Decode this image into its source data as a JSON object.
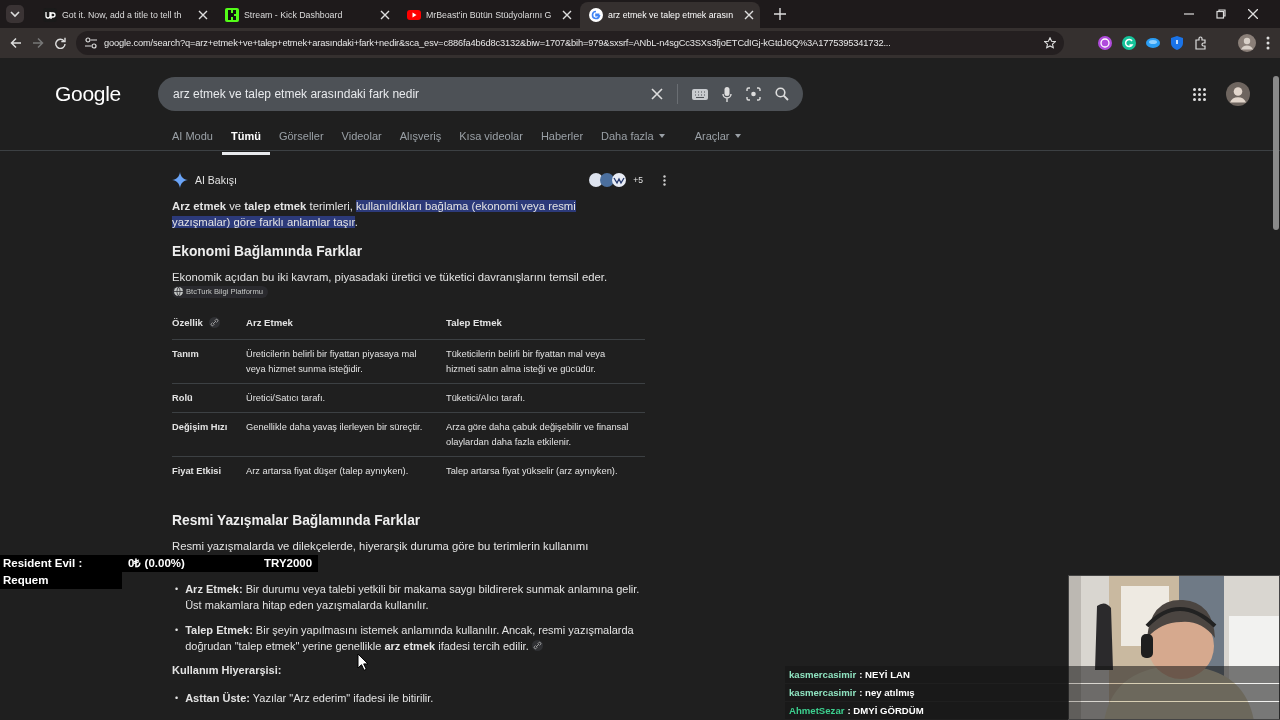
{
  "browser": {
    "tabs": [
      {
        "title": "Got it. Now, add a title to tell th",
        "selected": false
      },
      {
        "title": "Stream - Kick Dashboard",
        "selected": false
      },
      {
        "title": "MrBeast'in Bütün Stüdyolarını G",
        "selected": false
      },
      {
        "title": "arz etmek ve talep etmek arasın",
        "selected": true
      }
    ],
    "address": "google.com/search?q=arz+etmek+ve+talep+etmek+arasındaki+fark+nedir&sca_esv=c886fa4b6d8c3132&biw=1707&bih=979&sxsrf=ANbL-n4sgCc3SXs3fjoETCdIGj-kGtdJ6Q%3A1775395341732..."
  },
  "search": {
    "logo": "Google",
    "query": "arz etmek ve talep etmek arasındaki fark nedir",
    "nav": [
      {
        "label": "AI Modu",
        "selected": false,
        "dropdown": false
      },
      {
        "label": "Tümü",
        "selected": true,
        "dropdown": false
      },
      {
        "label": "Görseller",
        "selected": false,
        "dropdown": false
      },
      {
        "label": "Videolar",
        "selected": false,
        "dropdown": false
      },
      {
        "label": "Alışveriş",
        "selected": false,
        "dropdown": false
      },
      {
        "label": "Kısa videolar",
        "selected": false,
        "dropdown": false
      },
      {
        "label": "Haberler",
        "selected": false,
        "dropdown": false
      },
      {
        "label": "Daha fazla",
        "selected": false,
        "dropdown": true
      },
      {
        "label": "Araçlar",
        "selected": false,
        "dropdown": true
      }
    ]
  },
  "overview": {
    "title": "AI Bakışı",
    "source_count": "+5",
    "intro": "**Arz etmek** ve **talep etmek** terimleri, ",
    "intro_highlight": "kullanıldıkları bağlama (ekonomi veya resmi yazışmalar) göre farklı anlamlar taşır",
    "intro_end": ".",
    "section1": {
      "heading": "Ekonomi Bağlamında Farklar",
      "text": "Ekonomik açıdan bu iki kavram, piyasadaki üretici ve tüketici davranışlarını temsil eder.",
      "source": "BtcTurk Bilgi Platformu",
      "table": {
        "columns": [
          "Özellik",
          "Arz Etmek",
          "Talep Etmek"
        ],
        "rows": [
          [
            "Tanım",
            "Üreticilerin belirli bir fiyattan piyasaya mal veya hizmet sunma isteğidir.",
            "Tüketicilerin belirli bir fiyattan mal veya hizmeti satın alma isteği ve gücüdür."
          ],
          [
            "Rolü",
            "Üretici/Satıcı tarafı.",
            "Tüketici/Alıcı tarafı."
          ],
          [
            "Değişim Hızı",
            "Genellikle daha yavaş ilerleyen bir süreçtir.",
            "Arza göre daha çabuk değişebilir ve finansal olaylardan daha fazla etkilenir."
          ],
          [
            "Fiyat Etkisi",
            "Arz artarsa fiyat düşer (talep aynıyken).",
            "Talep artarsa fiyat yükselir (arz aynıyken)."
          ]
        ]
      }
    },
    "section2": {
      "heading": "Resmi Yazışmalar Bağlamında Farklar",
      "text": "Resmi yazışmalarda ve dilekçelerde, hiyerarşik duruma göre bu terimlerin kullanımı",
      "bullets": [
        {
          "marker": "•",
          "text": "**Arz Etmek:** Bir durumu veya talebi yetkili bir makama saygı bildirerek sunmak anlamına gelir. Üst makamlara hitap eden yazışmalarda kullanılır.",
          "link": false
        },
        {
          "marker": "•",
          "text": "**Talep Etmek:** Bir şeyin yapılmasını istemek anlamında kullanılır. Ancak, resmi yazışmalarda doğrudan \"talep etmek\" yerine genellikle **arz etmek** ifadesi tercih edilir.",
          "link": true
        }
      ],
      "subheading": "Kullanım Hiyerarşisi:",
      "bullets2": [
        {
          "marker": "•",
          "text": "**Asttan Üste:** Yazılar \"Arz ederim\" ifadesi ile bitirilir.",
          "link": false
        }
      ]
    }
  },
  "overlay": {
    "donation": {
      "name": "Resident Evil : Requem",
      "amount": "0₺ (0.00%)",
      "goal": "TRY2000"
    },
    "chat": [
      {
        "user": "kasmercasimir",
        "color": "#8fe3c0",
        "message": ": NEYİ LAN"
      },
      {
        "user": "kasmercasimir",
        "color": "#8fe3c0",
        "message": ": ney atılmış"
      },
      {
        "user": "AhmetSezar",
        "color": "#3ccf8e",
        "message": ": DMYİ GÖRDÜM"
      }
    ]
  }
}
